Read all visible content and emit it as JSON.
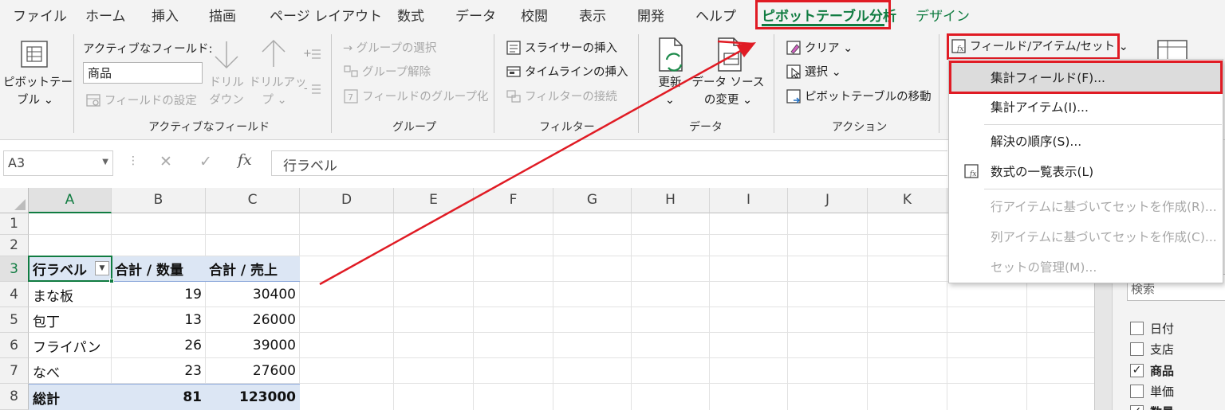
{
  "tabs": [
    "ファイル",
    "ホーム",
    "挿入",
    "描画",
    "ページ レイアウト",
    "数式",
    "データ",
    "校閲",
    "表示",
    "開発",
    "ヘルプ",
    "ピボットテーブル分析",
    "デザイン"
  ],
  "ribbon": {
    "pivot_label1": "ピボットテー",
    "pivot_label2": "ブル ⌄",
    "active_field_title": "アクティブなフィールド:",
    "active_field_value": "商品",
    "field_settings": "フィールドの設定",
    "drill_down1": "ドリル",
    "drill_down2": "ダウン",
    "drill_up1": "ドリルアッ",
    "drill_up2": "プ ⌄",
    "group_active_field": "アクティブなフィールド",
    "group_selection": "→ グループの選択",
    "ungroup": "グループ解除",
    "group_field": "フィールドのグループ化",
    "group_group": "グループ",
    "insert_slicer": "スライサーの挿入",
    "insert_timeline": "タイムラインの挿入",
    "filter_connections": "フィルターの接続",
    "group_filter": "フィルター",
    "refresh1": "更新",
    "refresh2": "⌄",
    "change_source1": "データ ソース",
    "change_source2": "の変更 ⌄",
    "group_data": "データ",
    "clear": "クリア ⌄",
    "select": "選択 ⌄",
    "move_pivot": "ピボットテーブルの移動",
    "group_action": "アクション",
    "fields_items_sets": "フィールド/アイテム/セット ⌄"
  },
  "formula_bar": {
    "name_box": "A3",
    "cancel": "✕",
    "enter": "✓",
    "fx": "fx",
    "content": "行ラベル"
  },
  "grid": {
    "columns": [
      "A",
      "B",
      "C",
      "D",
      "E",
      "F",
      "G",
      "H",
      "I",
      "J",
      "K"
    ],
    "rows": [
      "1",
      "2",
      "3",
      "4",
      "5",
      "6",
      "7",
      "8"
    ],
    "pivot_header": [
      "行ラベル",
      "合計 / 数量",
      "合計 / 売上"
    ],
    "pivot_rows": [
      [
        "まな板",
        "19",
        "30400"
      ],
      [
        "包丁",
        "13",
        "26000"
      ],
      [
        "フライパン",
        "26",
        "39000"
      ],
      [
        "なべ",
        "23",
        "27600"
      ]
    ],
    "pivot_total": [
      "総計",
      "81",
      "123000"
    ]
  },
  "dropdown": {
    "items": [
      "集計フィールド(F)...",
      "集計アイテム(I)...",
      "解決の順序(S)...",
      "数式の一覧表示(L)",
      "行アイテムに基づいてセットを作成(R)...",
      "列アイテムに基づいてセットを作成(C)...",
      "セットの管理(M)..."
    ]
  },
  "pane": {
    "search_placeholder": "検索",
    "fields": [
      {
        "label": "日付",
        "checked": false
      },
      {
        "label": "支店",
        "checked": false
      },
      {
        "label": "商品",
        "checked": true
      },
      {
        "label": "単価",
        "checked": false
      },
      {
        "label": "数量",
        "checked": true
      }
    ]
  },
  "colors": {
    "accent_green": "#107c41",
    "annotation_red": "#e01b24",
    "pivot_header_bg": "#dce6f4"
  }
}
